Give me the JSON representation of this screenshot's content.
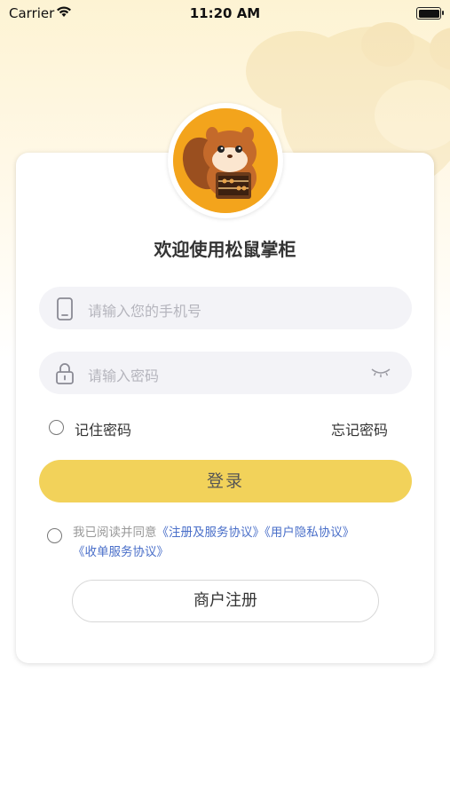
{
  "status_bar": {
    "carrier": "Carrier",
    "time": "11:20 AM"
  },
  "login": {
    "title": "欢迎使用松鼠掌柜",
    "phone_placeholder": "请输入您的手机号",
    "password_placeholder": "请输入密码",
    "remember_label": "记住密码",
    "forgot_label": "忘记密码",
    "login_button": "登录",
    "agreement": {
      "prefix": "我已阅读并同意",
      "link_service": "《注册及服务协议》",
      "link_privacy": "《用户隐私协议》",
      "link_receipt": "《收单服务协议》"
    },
    "merchant_register_button": "商户注册"
  },
  "colors": {
    "accent": "#f2d25a",
    "link": "#4a6fc9",
    "avatar_bg": "#f3a41c"
  }
}
